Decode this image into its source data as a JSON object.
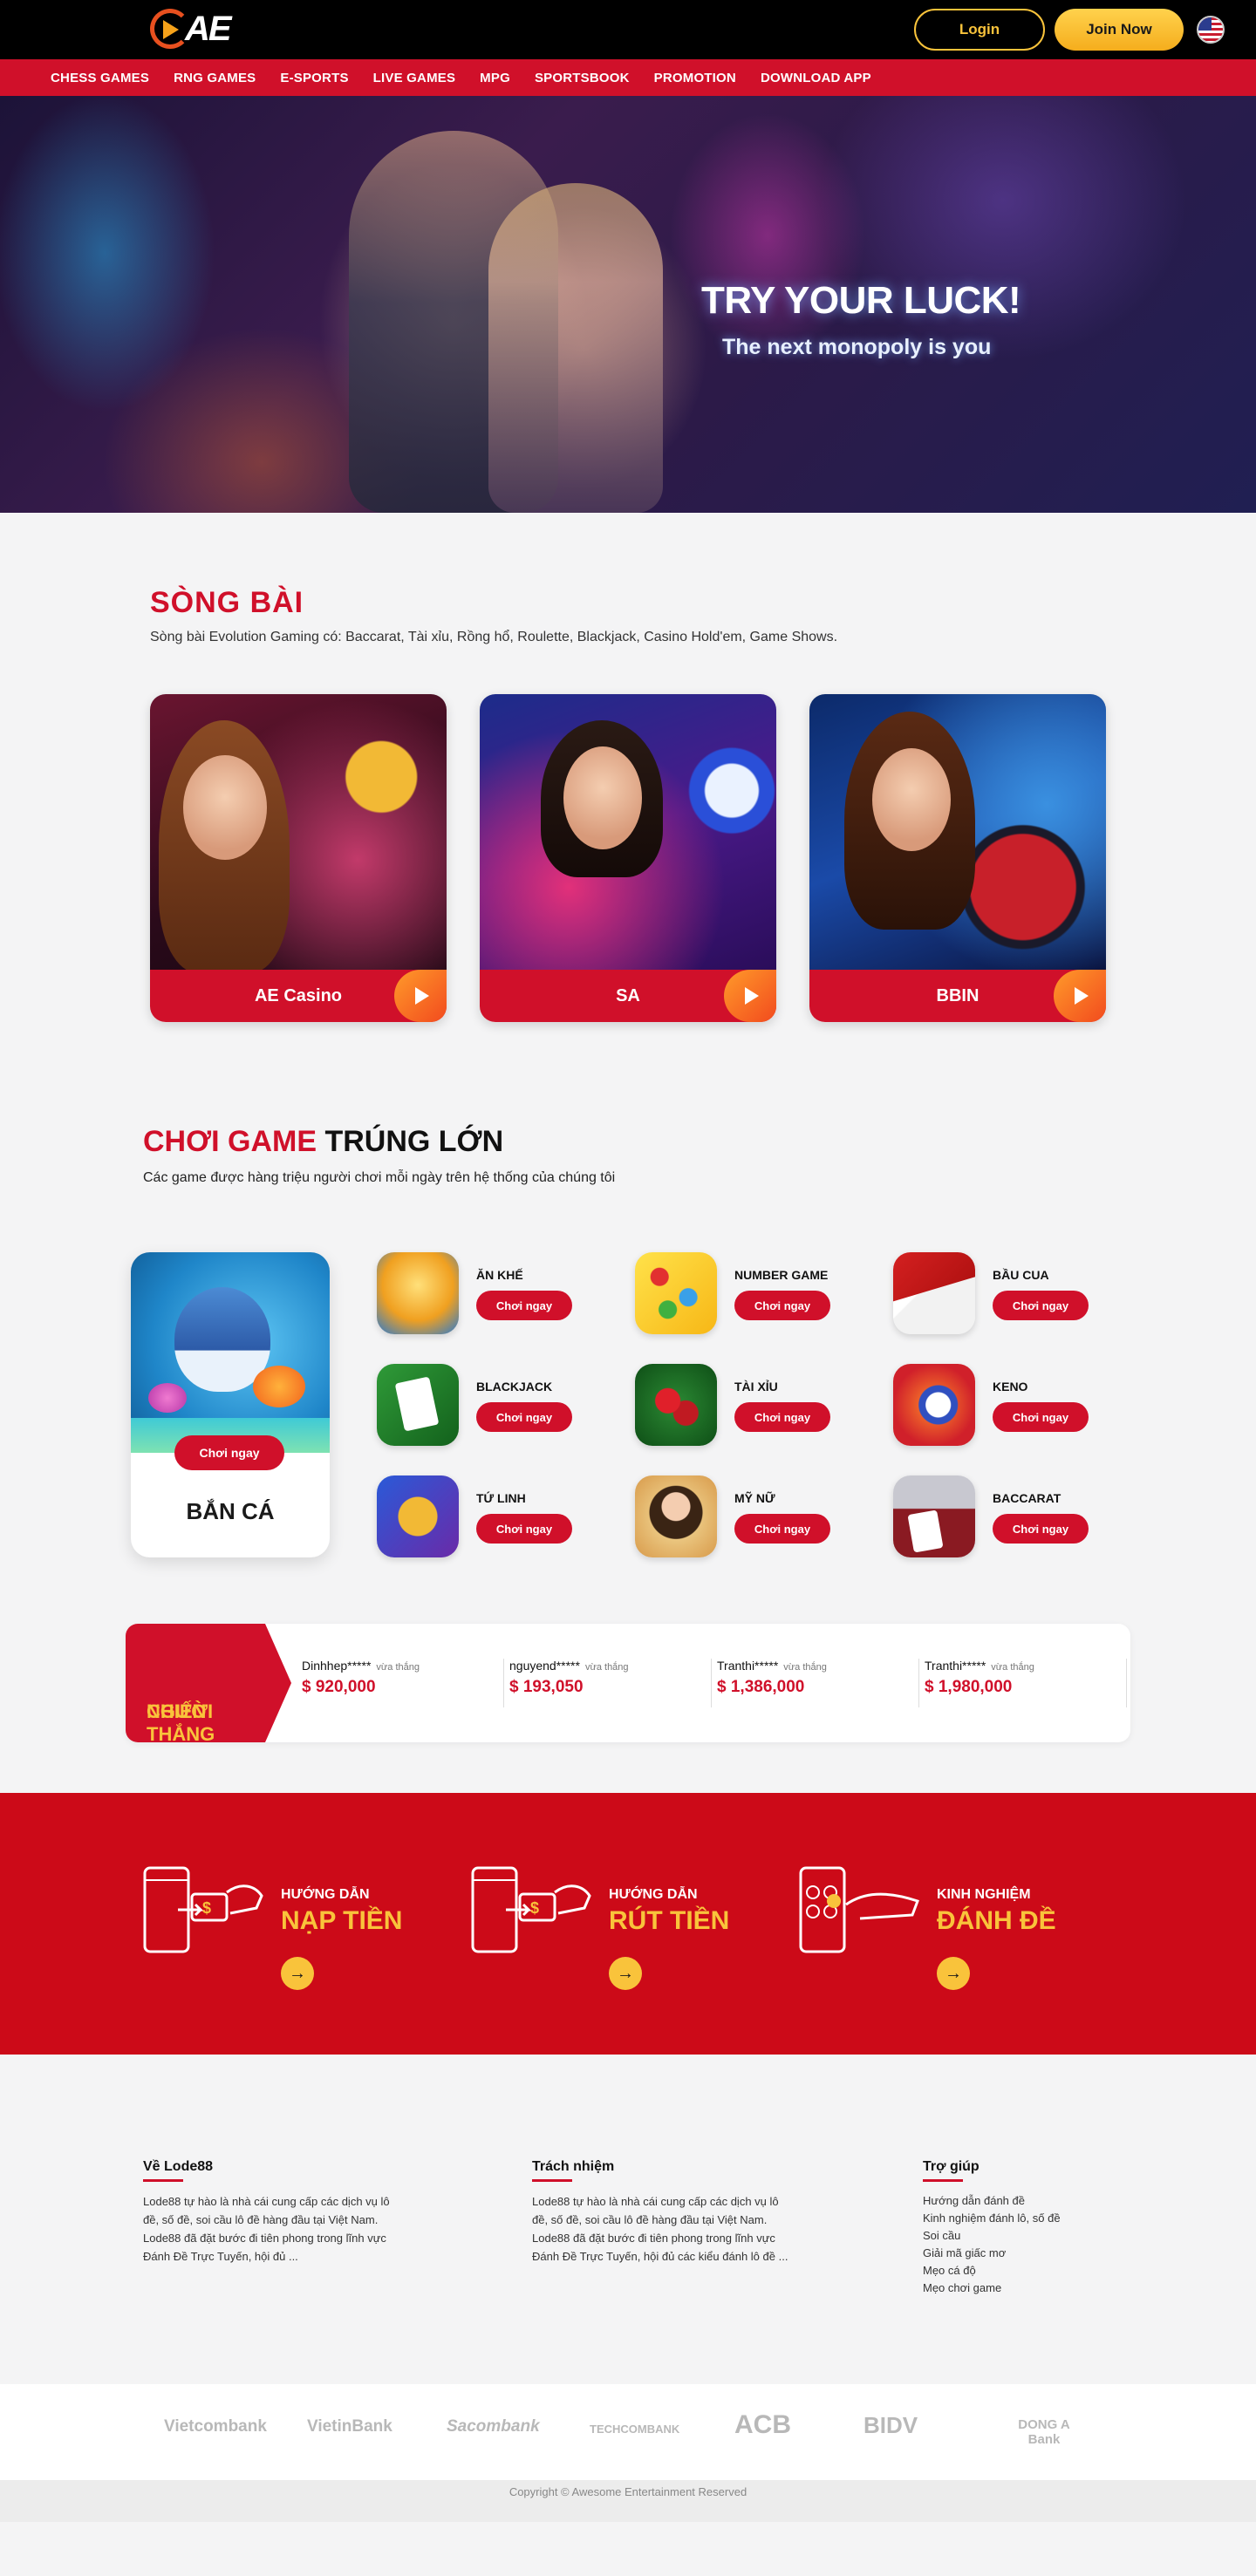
{
  "header": {
    "logo_text": "AE",
    "login_label": "Login",
    "join_label": "Join Now"
  },
  "nav": [
    "CHESS GAMES",
    "RNG GAMES",
    "E-SPORTS",
    "LIVE GAMES",
    "MPG",
    "SPORTSBOOK",
    "PROMOTION",
    "DOWNLOAD APP"
  ],
  "hero": {
    "title": "TRY YOUR LUCK!",
    "subtitle": "The next monopoly is you"
  },
  "casino": {
    "title": "SÒNG BÀI",
    "description": "Sòng bài Evolution Gaming có: Baccarat, Tài xỉu, Rồng hổ, Roulette, Blackjack, Casino Hold'em, Game Shows.",
    "cards": [
      "AE Casino",
      "SA",
      "BBIN"
    ]
  },
  "games": {
    "title_red": "CHƠI GAME",
    "title_dark": "TRÚNG LỚN",
    "description": "Các game được hàng triệu người chơi mỗi ngày trên hệ thống của chúng tôi",
    "featured": {
      "name": "BẮN CÁ",
      "button": "Chơi ngay"
    },
    "items": [
      {
        "name": "ĂN KHẾ",
        "button": "Chơi ngay"
      },
      {
        "name": "NUMBER GAME",
        "button": "Chơi ngay"
      },
      {
        "name": "BẦU CUA",
        "button": "Chơi ngay"
      },
      {
        "name": "BLACKJACK",
        "button": "Chơi ngay"
      },
      {
        "name": "TÀI XỈU",
        "button": "Chơi ngay"
      },
      {
        "name": "KENO",
        "button": "Chơi ngay"
      },
      {
        "name": "TỨ LINH",
        "button": "Chơi ngay"
      },
      {
        "name": "MỸ NỮ",
        "button": "Chơi ngay"
      },
      {
        "name": "BACCARAT",
        "button": "Chơi ngay"
      }
    ]
  },
  "winners": {
    "label_line1": "NGƯỜI",
    "label_line2": "CHIẾN THẮNG",
    "items": [
      {
        "name": "Dinhhep*****",
        "note": "vừa thắng",
        "amount": "$ 920,000"
      },
      {
        "name": "nguyend*****",
        "note": "vừa thắng",
        "amount": "$ 193,050"
      },
      {
        "name": "Tranthi*****",
        "note": "vừa thắng",
        "amount": "$ 1,386,000"
      },
      {
        "name": "Tranthi*****",
        "note": "vừa thắng",
        "amount": "$ 1,980,000"
      }
    ]
  },
  "guides": [
    {
      "small": "HƯỚNG DẪN",
      "big": "NẠP TIỀN",
      "arrow": "→"
    },
    {
      "small": "HƯỚNG DẪN",
      "big": "RÚT TIỀN",
      "arrow": "→"
    },
    {
      "small": "KINH NGHIỆM",
      "big": "ĐÁNH ĐỀ",
      "arrow": "→"
    }
  ],
  "footer": {
    "about": {
      "title": "Về Lode88",
      "text": "Lode88 tự hào là nhà cái cung cấp các dịch vụ lô đề, số đề, soi cầu lô đề hàng đầu tại Việt Nam. Lode88 đã đặt bước đi tiên phong trong lĩnh vực Đánh Đề Trực Tuyến, hội đủ ..."
    },
    "responsibility": {
      "title": "Trách nhiệm",
      "text": "Lode88 tự hào là nhà cái cung cấp các dịch vụ lô đề, số đề, soi cầu lô đề hàng đầu tại Việt Nam. Lode88 đã đặt bước đi tiên phong trong lĩnh vực Đánh Đề Trực Tuyến, hội đủ các kiểu đánh lô đề ..."
    },
    "help": {
      "title": "Trợ giúp",
      "links": [
        "Hướng dẫn đánh đề",
        "Kinh nghiệm đánh lô, số đề",
        "Soi cầu",
        "Giải mã giấc mơ",
        "Mẹo cá độ",
        "Mẹo chơi game"
      ]
    }
  },
  "banks": [
    "Vietcombank",
    "VietinBank",
    "Sacombank",
    "TECHCOMBANK",
    "ACB",
    "BIDV",
    "DONG A Bank"
  ],
  "copyright": "Copyright © Awesome Entertainment Reserved"
}
